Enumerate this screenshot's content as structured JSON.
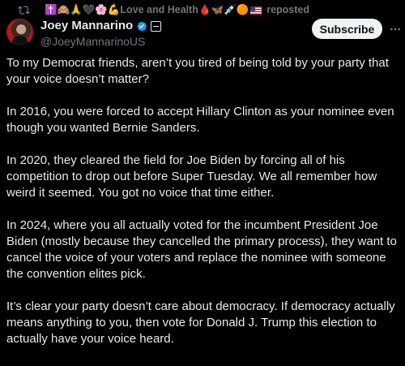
{
  "repost": {
    "icon": "repost-icon",
    "emojis_prefix": "✝️🙈🙏🖤🌸💪",
    "name_text": "Love and Health",
    "emojis_suffix": "🩸🦋💉🟠",
    "suffix": "reposted"
  },
  "author": {
    "display_name": "Joey Mannarino",
    "handle": "@JoeyMannarinoUS",
    "verified_color": "#1d9bf0"
  },
  "actions": {
    "subscribe_label": "Subscribe",
    "more_icon": "more-horizontal-icon"
  },
  "post": {
    "paragraphs": [
      "To my Democrat friends, aren’t you tired of being told by your party that your voice doesn’t matter?",
      "In 2016, you were forced to accept Hillary Clinton as your nominee even though you wanted Bernie Sanders.",
      "In 2020, they cleared the field for Joe Biden by forcing all of his competition to drop out before Super Tuesday. We all remember how weird it seemed. You got no voice that time either.",
      "In 2024, where you all actually voted for the incumbent President Joe Biden (mostly because they cancelled the primary process), they want to cancel the voice of your voters and replace the nominee with someone the convention elites pick.",
      "It’s clear your party doesn’t care about democracy. If democracy actually means anything to you, then vote for Donald J. Trump this election to actually have your voice heard."
    ]
  },
  "colors": {
    "background": "#000000",
    "text": "#e7e9ea",
    "muted": "#71767b",
    "button_bg": "#eff3f4"
  }
}
